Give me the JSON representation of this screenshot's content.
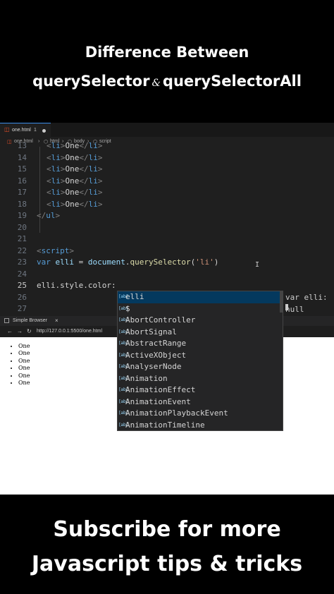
{
  "headline": {
    "line1": "Difference Between",
    "line2_left": "querySelector",
    "line2_amp": "&",
    "line2_right": "querySelectorAll"
  },
  "editor": {
    "tab": {
      "name": "one.html",
      "count": "1"
    },
    "breadcrumb": [
      "one.html",
      "html",
      "body",
      "script"
    ],
    "lines": [
      {
        "num": "13",
        "code": "<li>One</li>"
      },
      {
        "num": "14",
        "code": "<li>One</li>"
      },
      {
        "num": "15",
        "code": "<li>One</li>"
      },
      {
        "num": "16",
        "code": "<li>One</li>"
      },
      {
        "num": "17",
        "code": "<li>One</li>"
      },
      {
        "num": "18",
        "code": "<li>One</li>"
      },
      {
        "num": "19",
        "code": "</ul>"
      },
      {
        "num": "20",
        "code": ""
      },
      {
        "num": "21",
        "code": ""
      },
      {
        "num": "22",
        "code": "<script>"
      },
      {
        "num": "23",
        "code": "var elli = document.querySelector('li')"
      },
      {
        "num": "24",
        "code": ""
      },
      {
        "num": "25",
        "code": "elli.style.color:"
      },
      {
        "num": "26",
        "code": ""
      },
      {
        "num": "27",
        "code": ""
      }
    ],
    "line23": {
      "kw": "var",
      "name": "elli",
      "eq": " = ",
      "obj": "document",
      "dot": ".",
      "fn": "querySelector",
      "open": "(",
      "str": "'li'",
      "close": ")"
    },
    "line25": "elli.style.color:",
    "hover_hint": {
      "line1": "var elli: ",
      "line2": "null"
    }
  },
  "browser": {
    "tab_label": "Simple Browser",
    "close": "×",
    "back": "←",
    "forward": "→",
    "reload": "↻",
    "url": "http://127.0.0.1:5500/one.html",
    "list_items": [
      "One",
      "One",
      "One",
      "One",
      "One",
      "One"
    ]
  },
  "autocomplete": {
    "icon_text": "[ab]",
    "items": [
      "elli",
      "$",
      "AbortController",
      "AbortSignal",
      "AbstractRange",
      "ActiveXObject",
      "AnalyserNode",
      "Animation",
      "AnimationEffect",
      "AnimationEvent",
      "AnimationPlaybackEvent",
      "AnimationTimeline"
    ]
  },
  "footer": {
    "line1": "Subscribe for more",
    "line2": "Javascript tips & tricks"
  }
}
